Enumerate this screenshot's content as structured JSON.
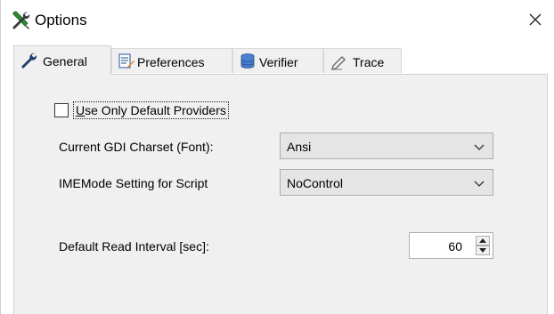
{
  "window": {
    "title": "Options",
    "close_glyph": "✕"
  },
  "tabs": [
    {
      "label": "General",
      "icon": "wrench-icon",
      "active": true
    },
    {
      "label": "Preferences",
      "icon": "preferences-icon",
      "active": false
    },
    {
      "label": "Verifier",
      "icon": "database-icon",
      "active": false
    },
    {
      "label": "Trace",
      "icon": "pen-icon",
      "active": false
    }
  ],
  "general": {
    "use_default_providers": {
      "label_first": "U",
      "label_rest": "se Only Default Providers",
      "checked": false
    },
    "gdi_charset": {
      "label": "Current GDI Charset (Font):",
      "value": "Ansi"
    },
    "imemode": {
      "label": "IMEMode Setting for Script",
      "value": "NoControl"
    },
    "read_interval": {
      "label": "Default Read Interval [sec]:",
      "value": "60"
    }
  },
  "colors": {
    "panel_bg": "#f0f0f0",
    "border": "#d0d0d0",
    "combo_bg": "#e5e5e5"
  }
}
